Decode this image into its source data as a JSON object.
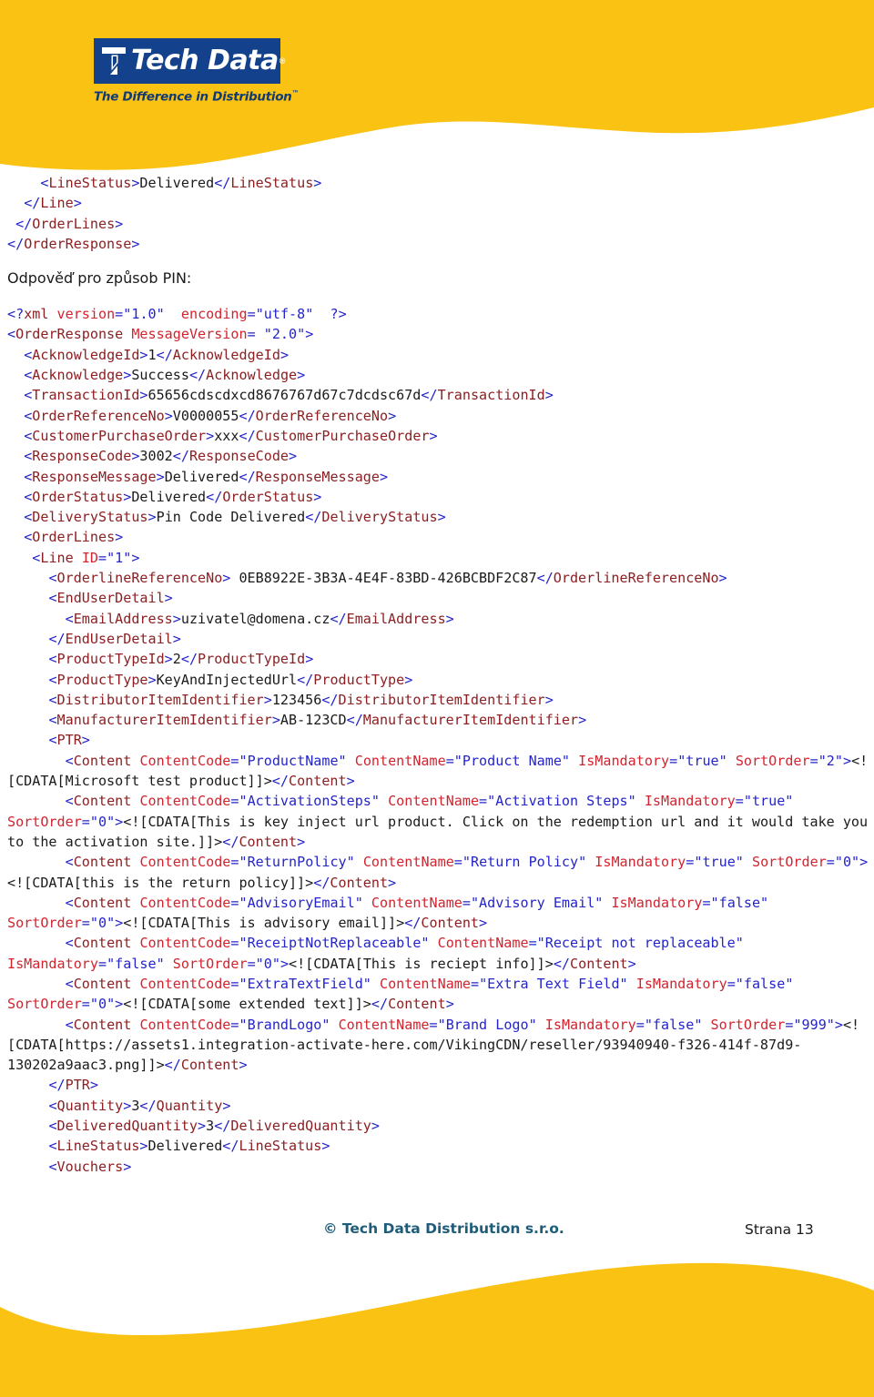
{
  "brand": {
    "logo_wordmark": "Tech Data",
    "logo_registered": "®",
    "logo_tagline": "The Difference in Distribution",
    "logo_tm": "™",
    "yellow": "#FAC213",
    "logo_plate_blue": "#14418B",
    "tagline_blue": "#123A72"
  },
  "code_top": {
    "lines": "    <LineStatus>Delivered</LineStatus>\n  </Line>\n </OrderLines>\n</OrderResponse>"
  },
  "prose": {
    "caption": "Odpověď pro způsob PIN:"
  },
  "xml": {
    "declaration_target": "<?xml",
    "declaration_attrs": "version=\"1.0\"  encoding=\"utf-8\"  ?>",
    "root_open": "<OrderResponse MessageVersion= \"2.0\">",
    "acknowledge_id": "1",
    "acknowledge": "Success",
    "transaction_id": "65656cdscdxcd8676767d67c7dcdsc67d",
    "order_reference_no": "V0000055",
    "customer_purchase_order": "xxx",
    "response_code": "3002",
    "response_message": "Delivered",
    "order_status": "Delivered",
    "delivery_status": "Pin Code Delivered",
    "line_id": "1",
    "orderline_reference_no": "0EB8922E-3B3A-4E4F-83BD-426BCBDF2C87",
    "email_address": "uzivatel@domena.cz",
    "product_type_id": "2",
    "product_type": "KeyAndInjectedUrl",
    "distributor_item_identifier": "123456",
    "manufacturer_item_identifier": "AB-123CD",
    "quantity": "3",
    "delivered_quantity": "3",
    "line_status": "Delivered",
    "contents": [
      {
        "content_code": "ProductName",
        "content_name": "Product Name",
        "is_mandatory": "true",
        "sort_order": "2",
        "cdata": "Microsoft test product"
      },
      {
        "content_code": "ActivationSteps",
        "content_name": "Activation Steps",
        "is_mandatory": "true",
        "sort_order": "0",
        "cdata": "This is key inject url product. Click on the redemption url and it would take you to the activation site."
      },
      {
        "content_code": "ReturnPolicy",
        "content_name": "Return Policy",
        "is_mandatory": "true",
        "sort_order": "0",
        "cdata": "this is the return policy"
      },
      {
        "content_code": "AdvisoryEmail",
        "content_name": "Advisory Email",
        "is_mandatory": "false",
        "sort_order": "0",
        "cdata": "This is advisory email"
      },
      {
        "content_code": "ReceiptNotReplaceable",
        "content_name": "Receipt not replaceable",
        "is_mandatory": "false",
        "sort_order": "0",
        "cdata": "This is reciept info"
      },
      {
        "content_code": "ExtraTextField",
        "content_name": "Extra Text Field",
        "is_mandatory": "false",
        "sort_order": "0",
        "cdata": "some extended text"
      },
      {
        "content_code": "BrandLogo",
        "content_name": "Brand Logo",
        "is_mandatory": "false",
        "sort_order": "999",
        "cdata": "https://assets1.integration-activate-here.com/VikingCDN/reseller/93940940-f326-414f-87d9-130202a9aac3.png"
      }
    ]
  },
  "footer": {
    "copyright": "© Tech Data Distribution s.r.o.",
    "page_label": "Strana 13"
  }
}
